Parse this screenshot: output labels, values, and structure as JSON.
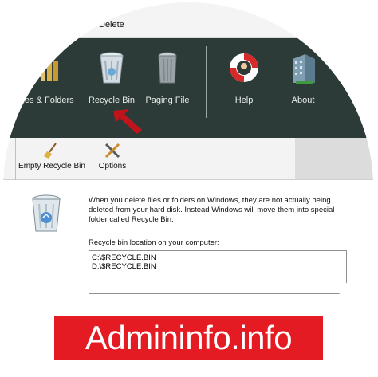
{
  "window": {
    "title": "Delete"
  },
  "ribbon": {
    "buttons": [
      {
        "label": "Files & Folders",
        "icon": "files-folders-icon"
      },
      {
        "label": "Recycle Bin",
        "icon": "recycle-bin-icon"
      },
      {
        "label": "Paging File",
        "icon": "paging-file-icon"
      },
      {
        "label": "Help",
        "icon": "lifebuoy-help-icon"
      },
      {
        "label": "About",
        "icon": "building-about-icon"
      }
    ]
  },
  "toolbar": {
    "empty_label": "Empty Recycle Bin",
    "options_label": "Options"
  },
  "content": {
    "description": "When you delete files or folders on Windows, they are not actually being deleted from your hard disk. Instead Windows will move them into special folder called Recycle Bin.",
    "location_label": "Recycle bin location on your computer:",
    "locations": [
      "C:\\$RECYCLE.BIN",
      "D:\\$RECYCLE.BIN"
    ]
  },
  "watermark": {
    "text": "Admininfo.info"
  },
  "colors": {
    "ribbon": "#2c3b37",
    "banner": "#e51b23",
    "arrow": "#c0141c"
  }
}
